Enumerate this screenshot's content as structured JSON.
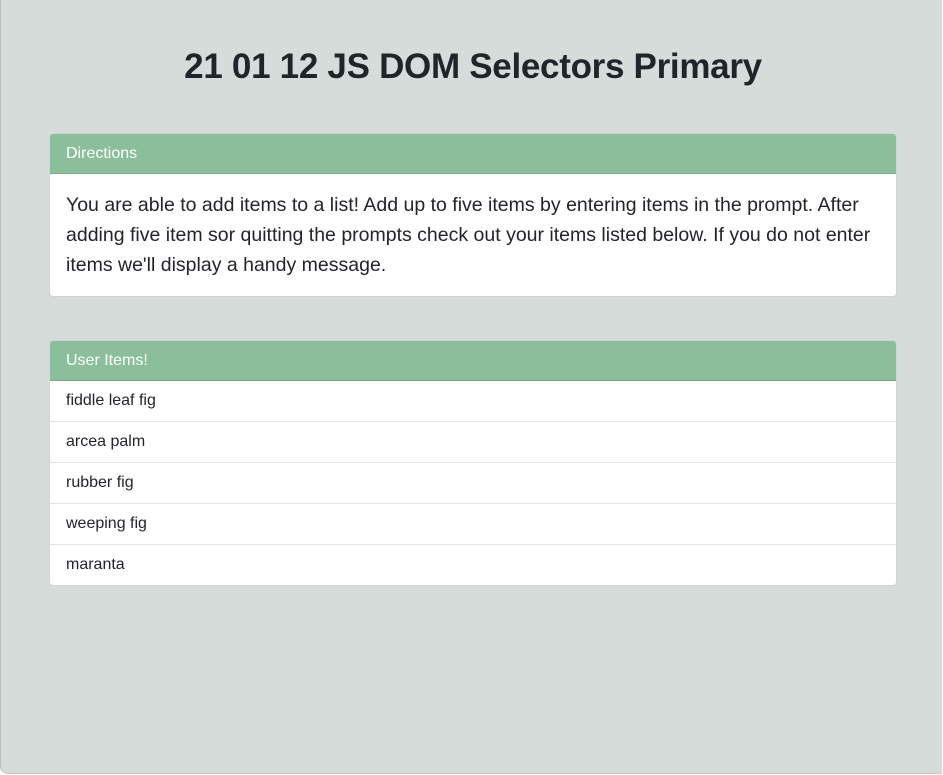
{
  "page": {
    "title": "21 01 12 JS DOM Selectors Primary"
  },
  "directions": {
    "header": "Directions",
    "body": "You are able to add items to a list! Add up to five items by entering items in the prompt. After adding five item sor quitting the prompts check out your items listed below. If you do not enter items we'll display a handy message."
  },
  "user_items": {
    "header": "User Items!",
    "items": [
      "fiddle leaf fig",
      "arcea palm",
      "rubber fig",
      "weeping fig",
      "maranta"
    ]
  },
  "colors": {
    "page_background": "#d6dcd9",
    "card_header": "#8bbf9b",
    "card_body": "#ffffff",
    "text": "#212529"
  }
}
